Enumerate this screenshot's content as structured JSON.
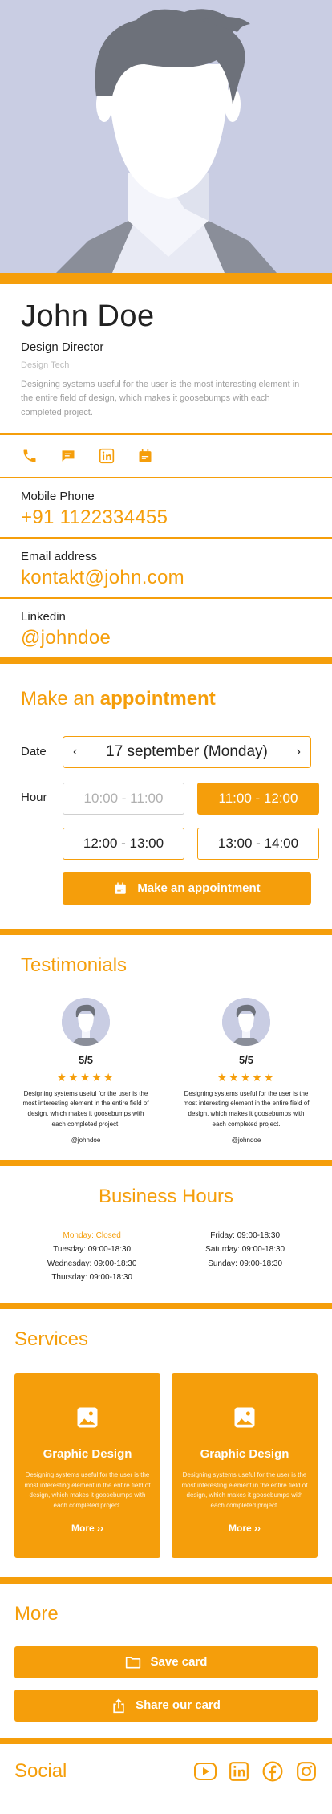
{
  "profile": {
    "name": "John Doe",
    "role": "Design Director",
    "company": "Design Tech",
    "bio": "Designing systems useful for the user is the most interesting element in the entire field of design, which makes it goosebumps with each completed project."
  },
  "quick_actions": [
    {
      "icon": "phone-icon"
    },
    {
      "icon": "chat-icon"
    },
    {
      "icon": "linkedin-icon"
    },
    {
      "icon": "calendar-icon"
    }
  ],
  "contacts": [
    {
      "label": "Mobile Phone",
      "value": "+91 1122334455"
    },
    {
      "label": "Email address",
      "value": "kontakt@john.com"
    },
    {
      "label": "Linkedin",
      "value": "@johndoe"
    }
  ],
  "appointment": {
    "title_prefix": "Make an ",
    "title_strong": "appointment",
    "date_label": "Date",
    "date_value": "17 september (Monday)",
    "hour_label": "Hour",
    "slots": [
      {
        "label": "10:00 - 11:00",
        "state": "disabled"
      },
      {
        "label": "11:00 - 12:00",
        "state": "selected"
      },
      {
        "label": "12:00 - 13:00",
        "state": "available"
      },
      {
        "label": "13:00 - 14:00",
        "state": "available"
      }
    ],
    "button_label": "Make an appointment"
  },
  "testimonials": {
    "title": "Testimonials",
    "items": [
      {
        "score": "5/5",
        "stars": "★★★★★",
        "text": "Designing systems useful for the user is the most interesting element in the entire field of design, which makes it goosebumps with each completed project.",
        "handle": "@johndoe"
      },
      {
        "score": "5/5",
        "stars": "★★★★★",
        "text": "Designing systems useful for the user is the most interesting element in the entire field of design, which makes it goosebumps with each completed project.",
        "handle": "@johndoe"
      }
    ]
  },
  "business_hours": {
    "title": "Business Hours",
    "left": [
      "Monday: Closed",
      "Tuesday: 09:00-18:30",
      "Wednesday: 09:00-18:30",
      "Thursday: 09:00-18:30"
    ],
    "right": [
      "Friday: 09:00-18:30",
      "Saturday: 09:00-18:30",
      "Sunday: 09:00-18:30"
    ]
  },
  "services": {
    "title": "Services",
    "items": [
      {
        "title": "Graphic Design",
        "text": "Designing systems useful for the user is the most interesting element in the entire field of design, which makes it goosebumps with each completed project.",
        "more": "More ››"
      },
      {
        "title": "Graphic Design",
        "text": "Designing systems useful for the user is the most interesting element in the entire field of design, which makes it goosebumps with each completed project.",
        "more": "More ››"
      }
    ]
  },
  "more": {
    "title": "More",
    "save_label": "Save card",
    "share_label": "Share our card"
  },
  "social": {
    "title": "Social",
    "icons": [
      "youtube-icon",
      "linkedin-icon",
      "facebook-icon",
      "instagram-icon"
    ]
  },
  "colors": {
    "accent": "#f59e0b",
    "hero_bg": "#c9cde3"
  }
}
